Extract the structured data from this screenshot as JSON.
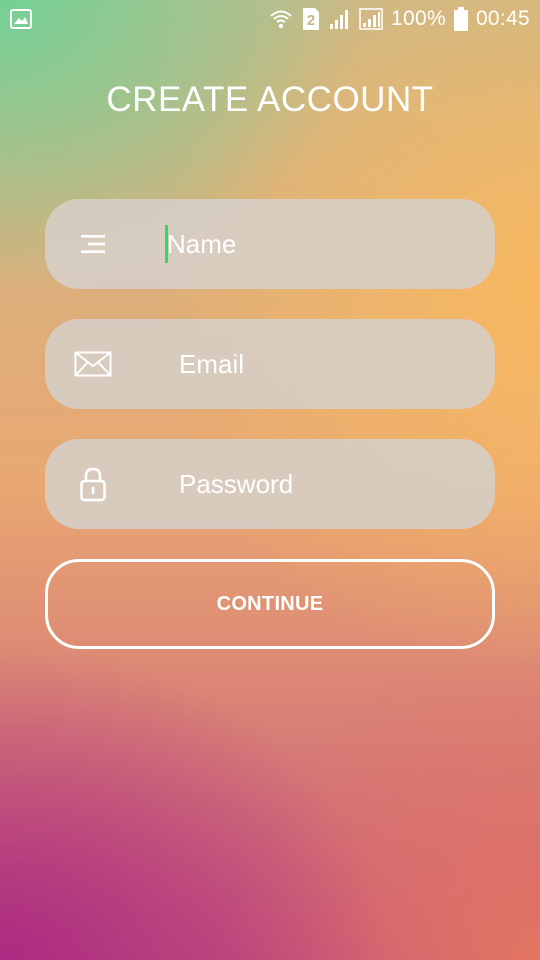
{
  "status_bar": {
    "left_icon": "gallery-notification-icon",
    "sim_badge": "2",
    "battery_percent": "100%",
    "time": "00:45",
    "icons": [
      "wifi-icon",
      "sim-2-icon",
      "signal-icon",
      "signal-icon",
      "battery-icon"
    ]
  },
  "title": "CREATE ACCOUNT",
  "form": {
    "name": {
      "placeholder": "Name",
      "value": "",
      "icon": "name-lines-icon"
    },
    "email": {
      "placeholder": "Email",
      "value": "",
      "icon": "envelope-icon"
    },
    "password": {
      "placeholder": "Password",
      "value": "",
      "icon": "lock-icon"
    }
  },
  "continue_label": "CONTINUE",
  "colors": {
    "cursor": "#2fd86a",
    "field_bg": "#d6cdc4",
    "text": "#ffffff"
  }
}
